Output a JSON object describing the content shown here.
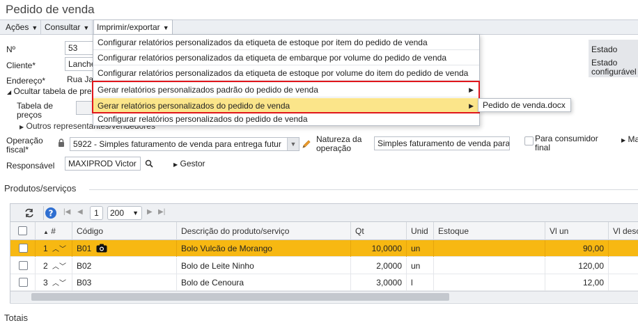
{
  "page": {
    "title": "Pedido de venda"
  },
  "menubar": {
    "acoes": "Ações",
    "consultar": "Consultar",
    "imprimir": "Imprimir/exportar"
  },
  "form": {
    "numero_label": "Nº",
    "numero_value": "53",
    "cliente_label": "Cliente*",
    "cliente_value": "Lanche",
    "endereco_label": "Endereço*",
    "endereco_value": "Rua Ja",
    "ocultar_tabela": "Ocultar tabela de pre",
    "tabela_precos_label_1": "Tabela de",
    "tabela_precos_label_2": "preços",
    "outros_representantes": "Outros representantes/vendedores",
    "operacao_label_1": "Operação",
    "operacao_label_2": "fiscal*",
    "operacao_value": "5922 - Simples faturamento de venda para entrega futur",
    "natureza_label_1": "Natureza da",
    "natureza_label_2": "operação",
    "natureza_value": "Simples faturamento de venda para",
    "consumidor_label_1": "Para consumidor",
    "consumidor_label_2": "final",
    "mais_label": "Ma",
    "responsavel_label": "Responsável",
    "responsavel_value": "MAXIPROD Victor",
    "gestor_label": "Gestor"
  },
  "side_panel": {
    "estado": "Estado",
    "estado_configuravel_1": "Estado",
    "estado_configuravel_2": "configurável"
  },
  "dropdown": {
    "items": [
      "Configurar relatórios personalizados da etiqueta de estoque por item do pedido de venda",
      "Configurar relatórios personalizados da etiqueta de embarque por volume do pedido de venda",
      "Configurar relatórios personalizados da etiqueta de estoque por volume do item do pedido de venda",
      "Gerar relatórios personalizados padrão do pedido de venda",
      "Gerar relatórios personalizados do pedido de venda",
      "Configurar relatórios personalizados do pedido de venda"
    ],
    "submenu_item": "Pedido de venda.docx"
  },
  "products": {
    "section_title": "Produtos/serviços",
    "pager": {
      "page": "1",
      "page_size": "200"
    },
    "columns": [
      "#",
      "Código",
      "Descrição do produto/serviço",
      "Qt",
      "Unid",
      "Estoque",
      "Vl un",
      "Vl desc"
    ],
    "rows": [
      {
        "num": "1",
        "codigo": "B01",
        "descricao": "Bolo Vulcão de Morango",
        "qt": "10,0000",
        "unid": "un",
        "estoque": "",
        "vl_un": "90,00"
      },
      {
        "num": "2",
        "codigo": "B02",
        "descricao": "Bolo de Leite Ninho",
        "qt": "2,0000",
        "unid": "un",
        "estoque": "",
        "vl_un": "120,00"
      },
      {
        "num": "3",
        "codigo": "B03",
        "descricao": "Bolo de Cenoura",
        "qt": "3,0000",
        "unid": "l",
        "estoque": "",
        "vl_un": "12,00"
      }
    ]
  },
  "footer": {
    "totais": "Totais"
  },
  "colors": {
    "highlight_row": "#f7b812",
    "menu_highlight": "#fbe58a",
    "annotation_red": "#e0161c",
    "link_blue": "#2f6fd1"
  }
}
